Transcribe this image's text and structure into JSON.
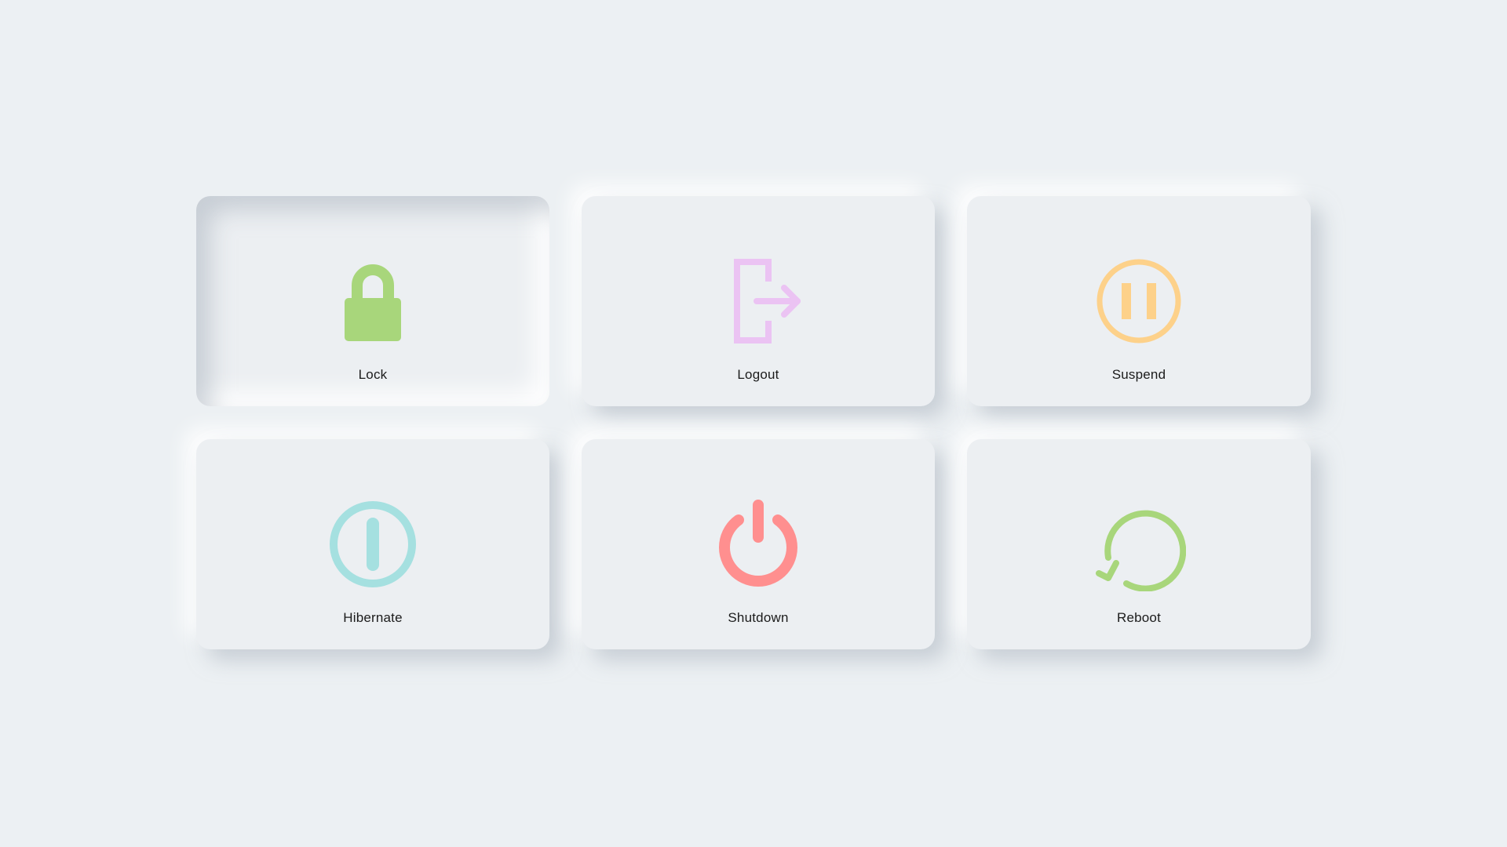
{
  "menu": {
    "items": [
      {
        "id": "lock",
        "label": "Lock",
        "icon": "lock-icon",
        "color": "#a8d67b",
        "selected": true
      },
      {
        "id": "logout",
        "label": "Logout",
        "icon": "logout-icon",
        "color": "#ebc3f3",
        "selected": false
      },
      {
        "id": "suspend",
        "label": "Suspend",
        "icon": "pause-circle-icon",
        "color": "#fdd18a",
        "selected": false
      },
      {
        "id": "hibernate",
        "label": "Hibernate",
        "icon": "hibernate-icon",
        "color": "#a5e0e0",
        "selected": false
      },
      {
        "id": "shutdown",
        "label": "Shutdown",
        "icon": "power-icon",
        "color": "#ff8f8f",
        "selected": false
      },
      {
        "id": "reboot",
        "label": "Reboot",
        "icon": "reboot-icon",
        "color": "#a8d67b",
        "selected": false
      }
    ]
  },
  "theme": {
    "background": "#ecf0f3",
    "tile_background": "#eceff2",
    "text_color": "#1b1b1b"
  }
}
